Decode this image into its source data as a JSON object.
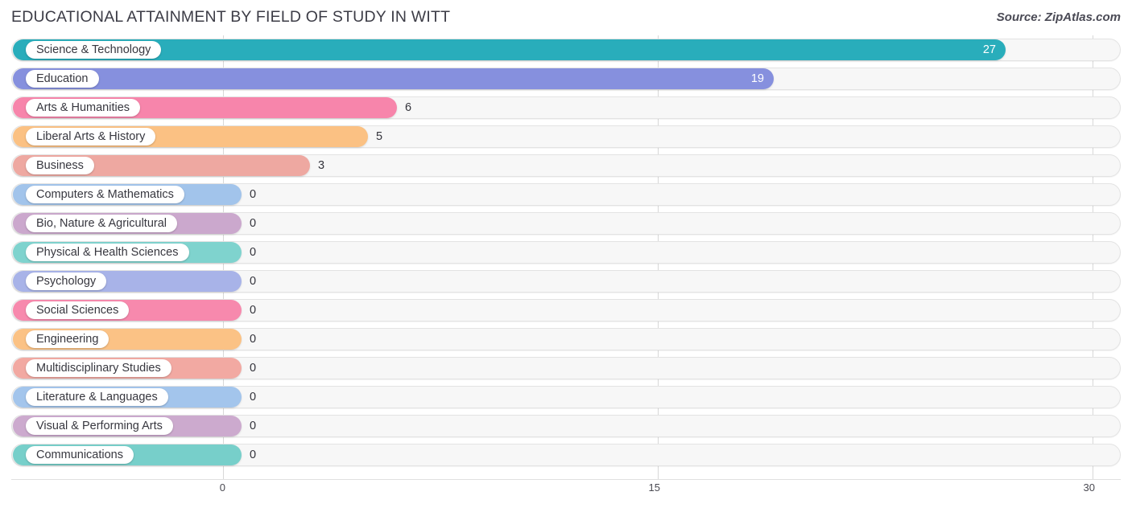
{
  "header": {
    "title": "EDUCATIONAL ATTAINMENT BY FIELD OF STUDY IN WITT",
    "source": "Source: ZipAtlas.com"
  },
  "chart_data": {
    "type": "bar",
    "orientation": "horizontal",
    "title": "EDUCATIONAL ATTAINMENT BY FIELD OF STUDY IN WITT",
    "xlabel": "",
    "ylabel": "",
    "xlim": [
      0,
      30
    ],
    "xticks": [
      0,
      15,
      30
    ],
    "xtick_labels": [
      "0",
      "15",
      "30"
    ],
    "grid": true,
    "legend": false,
    "categories": [
      "Science & Technology",
      "Education",
      "Arts & Humanities",
      "Liberal Arts & History",
      "Business",
      "Computers & Mathematics",
      "Bio, Nature & Agricultural",
      "Physical & Health Sciences",
      "Psychology",
      "Social Sciences",
      "Engineering",
      "Multidisciplinary Studies",
      "Literature & Languages",
      "Visual & Performing Arts",
      "Communications"
    ],
    "values": [
      27,
      19,
      6,
      5,
      3,
      0,
      0,
      0,
      0,
      0,
      0,
      0,
      0,
      0,
      0
    ],
    "value_labels": [
      "27",
      "19",
      "6",
      "5",
      "3",
      "0",
      "0",
      "0",
      "0",
      "0",
      "0",
      "0",
      "0",
      "0",
      "0"
    ],
    "colors": [
      "#29adbb",
      "#8690de",
      "#f785ab",
      "#fbc183",
      "#eea8a1",
      "#a2c4eb",
      "#cba8cd",
      "#7fd3ce",
      "#a8b3e8",
      "#f789ad",
      "#fbc285",
      "#f2a9a2",
      "#a3c5ec",
      "#ccaace",
      "#77cfca"
    ]
  }
}
